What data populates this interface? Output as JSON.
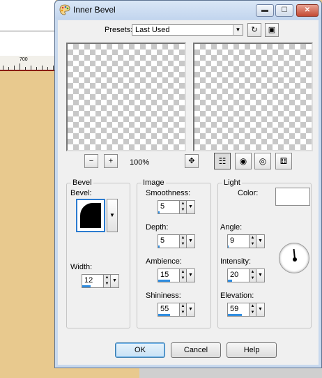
{
  "dialog": {
    "title": "Inner Bevel"
  },
  "presets": {
    "label": "Presets:",
    "value": "Last Used"
  },
  "zoom": {
    "level": "100%"
  },
  "bevel": {
    "group_label": "Bevel",
    "bevel_label": "Bevel:",
    "width_label": "Width:",
    "width_value": "12",
    "width_fraction": 0.4
  },
  "image": {
    "group_label": "Image",
    "smoothness_label": "Smoothness:",
    "smoothness_value": "5",
    "smoothness_fraction": 0.05,
    "depth_label": "Depth:",
    "depth_value": "5",
    "depth_fraction": 0.05,
    "ambience_label": "Ambience:",
    "ambience_value": "15",
    "ambience_fraction": 0.58,
    "shininess_label": "Shininess:",
    "shininess_value": "55",
    "shininess_fraction": 0.55
  },
  "light": {
    "group_label": "Light",
    "color_label": "Color:",
    "color_value": "#ffffff",
    "angle_label": "Angle:",
    "angle_value": "9",
    "angle_fraction": 0.02,
    "intensity_label": "Intensity:",
    "intensity_value": "20",
    "intensity_fraction": 0.2,
    "elevation_label": "Elevation:",
    "elevation_value": "59",
    "elevation_fraction": 0.65
  },
  "buttons": {
    "ok": "OK",
    "cancel": "Cancel",
    "help": "Help"
  },
  "ruler": {
    "label": "700"
  },
  "colors": {
    "accent": "#2f8de0",
    "canvas": "#e8c98e",
    "close": "#c44a34"
  }
}
